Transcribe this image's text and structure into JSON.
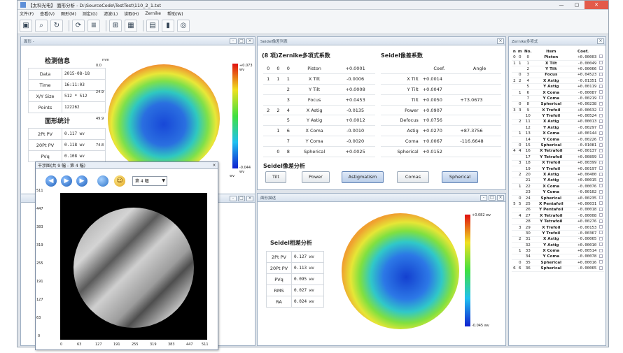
{
  "app": {
    "title": "【太科光电】 面形分析 - D:\\SourceCode\\TestTest\\110_2_1.txt",
    "menu": [
      "文件(F)",
      "查看(V)",
      "图形(M)",
      "测定(G)",
      "滤波(L)",
      "读取(H)",
      "Zernike",
      "帮助(W)"
    ]
  },
  "toolbar": {
    "icons": [
      "monitor-icon",
      "zoom-icon",
      "refresh-icon",
      "rotate-icon",
      "stack-icon",
      "filter-icon",
      "image-icon",
      "clipboard-icon",
      "barcode-icon",
      "target-icon"
    ]
  },
  "surface": {
    "title": "面形 -",
    "section_detect": "检测信息",
    "detect_rows": [
      {
        "k": "Data",
        "v": "2015-08-18"
      },
      {
        "k": "Time",
        "v": "16:11:03"
      },
      {
        "k": "X/Y Size",
        "v": "512 * 512"
      },
      {
        "k": "Points",
        "v": "122262"
      }
    ],
    "section_stats": "面形统计",
    "stat_rows": [
      {
        "k": "2Pt PV",
        "v": "0.117 wv"
      },
      {
        "k": "20Pt PV",
        "v": "0.118 wv"
      },
      {
        "k": "PVq",
        "v": "0.108 wv"
      }
    ],
    "axis_unit": "mm",
    "y_ticks": [
      "0.0",
      "24.9",
      "49.9",
      "74.8"
    ],
    "max_label": "+0.073 wv",
    "min_label": "-0.044 wv",
    "bar_unit": "wv"
  },
  "seidel_list": {
    "title": "Seidel像差列表",
    "zern_title": "(8 项)Zernike多项式系数",
    "seidel_title": "Seidel像差系数",
    "head_coef": "Coef.",
    "head_angle": "Angle",
    "zern_rows": [
      [
        "0",
        "0",
        "0",
        "Piston",
        "+0.0001"
      ],
      [
        "1",
        "1",
        "1",
        "X Tilt",
        "-0.0006"
      ],
      [
        "",
        "",
        "2",
        "Y Tilt",
        "+0.0008"
      ],
      [
        "",
        "",
        "3",
        "Focus",
        "+0.0453"
      ],
      [
        "2",
        "2",
        "4",
        "X Astig",
        "-0.0135"
      ],
      [
        "",
        "",
        "5",
        "Y Astig",
        "+0.0012"
      ],
      [
        "",
        "1",
        "6",
        "X Coma",
        "-0.0010"
      ],
      [
        "",
        "",
        "7",
        "Y Coma",
        "-0.0020"
      ],
      [
        "",
        "0",
        "8",
        "Spherical",
        "+0.0025"
      ]
    ],
    "seidel_rows": [
      [
        "X Tilt",
        "+0.0014",
        ""
      ],
      [
        "Y Tilt",
        "+0.0047",
        ""
      ],
      [
        "Tilt",
        "+0.0050",
        "+73.0673"
      ],
      [
        "Power",
        "+0.0907",
        ""
      ],
      [
        "Defocus",
        "+0.0756",
        ""
      ],
      [
        "Astig",
        "+0.0270",
        "+87.3756"
      ],
      [
        "Coma",
        "+0.0067",
        "-116.6648"
      ],
      [
        "Spherical",
        "+0.0152",
        ""
      ]
    ],
    "analysis_title": "Seidel像差分析",
    "buttons": [
      "Tilt",
      "Power",
      "Astigmatism",
      "Comas",
      "Spherical"
    ]
  },
  "zernike": {
    "title": "Zernike多项式",
    "headers": [
      "n",
      "m",
      "No.",
      "Item",
      "Coef."
    ],
    "rows": [
      [
        "0",
        "0",
        "0",
        "Piston",
        "+0.00003"
      ],
      [
        "1",
        "1",
        "1",
        "X Tilt",
        "-0.00049"
      ],
      [
        "",
        "",
        "2",
        "Y Tilt",
        "+0.00066"
      ],
      [
        "",
        "0",
        "3",
        "Focus",
        "+0.04523"
      ],
      [
        "2",
        "2",
        "4",
        "X Astig",
        "-0.01351"
      ],
      [
        "",
        "",
        "5",
        "Y Astig",
        "+0.00119"
      ],
      [
        "",
        "1",
        "6",
        "X Coma",
        "-0.00087"
      ],
      [
        "",
        "",
        "7",
        "Y Coma",
        "-0.00219"
      ],
      [
        "",
        "0",
        "8",
        "Spherical",
        "+0.00238"
      ],
      [
        "3",
        "3",
        "9",
        "X Trefoil",
        "+0.00632"
      ],
      [
        "",
        "",
        "10",
        "Y Trefoil",
        "+0.00524"
      ],
      [
        "",
        "2",
        "11",
        "X Astig",
        "+0.00013"
      ],
      [
        "",
        "",
        "12",
        "Y Astig",
        "-0.00297"
      ],
      [
        "",
        "1",
        "13",
        "X Coma",
        "+0.00144"
      ],
      [
        "",
        "",
        "14",
        "Y Coma",
        "-0.00226"
      ],
      [
        "",
        "0",
        "15",
        "Spherical",
        "-0.01081"
      ],
      [
        "4",
        "4",
        "16",
        "X Tetrafoil",
        "+0.00137"
      ],
      [
        "",
        "",
        "17",
        "Y Tetrafoil",
        "+0.00899"
      ],
      [
        "",
        "3",
        "18",
        "X Trefoil",
        "+0.00399"
      ],
      [
        "",
        "",
        "19",
        "Y Trefoil",
        "+0.00197"
      ],
      [
        "",
        "2",
        "20",
        "X Astig",
        "+0.00400"
      ],
      [
        "",
        "",
        "21",
        "Y Astig",
        "+0.00015"
      ],
      [
        "",
        "1",
        "22",
        "X Coma",
        "-0.00076"
      ],
      [
        "",
        "",
        "23",
        "Y Coma",
        "-0.00102"
      ],
      [
        "",
        "0",
        "24",
        "Spherical",
        "+0.00235"
      ],
      [
        "5",
        "5",
        "25",
        "X Pentafoil",
        "+0.00031"
      ],
      [
        "",
        "",
        "26",
        "Y Pentafoil",
        "-0.00018"
      ],
      [
        "",
        "4",
        "27",
        "X Tetrafoil",
        "-0.00008"
      ],
      [
        "",
        "",
        "28",
        "Y Tetrafoil",
        "+0.00276"
      ],
      [
        "",
        "3",
        "29",
        "X Trefoil",
        "-0.00153"
      ],
      [
        "",
        "",
        "30",
        "Y Trefoil",
        "-0.00367"
      ],
      [
        "",
        "2",
        "31",
        "X Astig",
        "-0.00065"
      ],
      [
        "",
        "",
        "32",
        "Y Astig",
        "+0.00010"
      ],
      [
        "",
        "1",
        "33",
        "X Coma",
        "+0.00514"
      ],
      [
        "",
        "",
        "34",
        "Y Coma",
        "-0.00078"
      ],
      [
        "",
        "0",
        "35",
        "Spherical",
        "+0.00016"
      ],
      [
        "6",
        "6",
        "36",
        "Spherical",
        "-0.00065"
      ]
    ]
  },
  "fringe": {
    "title": "干涉图(共 9 幅 - 第 4 幅)",
    "selector": "第 4 幅",
    "y_ticks": [
      "511",
      "447",
      "383",
      "319",
      "255",
      "191",
      "127",
      "63",
      "0"
    ],
    "x_ticks": [
      "0",
      "63",
      "127",
      "191",
      "255",
      "319",
      "383",
      "447",
      "511"
    ]
  },
  "seidel_map": {
    "title": "面形描述",
    "section": "Seidel相差分析",
    "rows": [
      {
        "k": "2Pt PV",
        "v": "0.127 wv"
      },
      {
        "k": "20Pt PV",
        "v": "0.113 wv"
      },
      {
        "k": "PVq",
        "v": "0.095 wv"
      },
      {
        "k": "RMS",
        "v": "0.027 wv"
      },
      {
        "k": "RA",
        "v": "0.024 wv"
      }
    ],
    "max_label": "+0.082 wv",
    "min_label": "-0.045 wv"
  }
}
